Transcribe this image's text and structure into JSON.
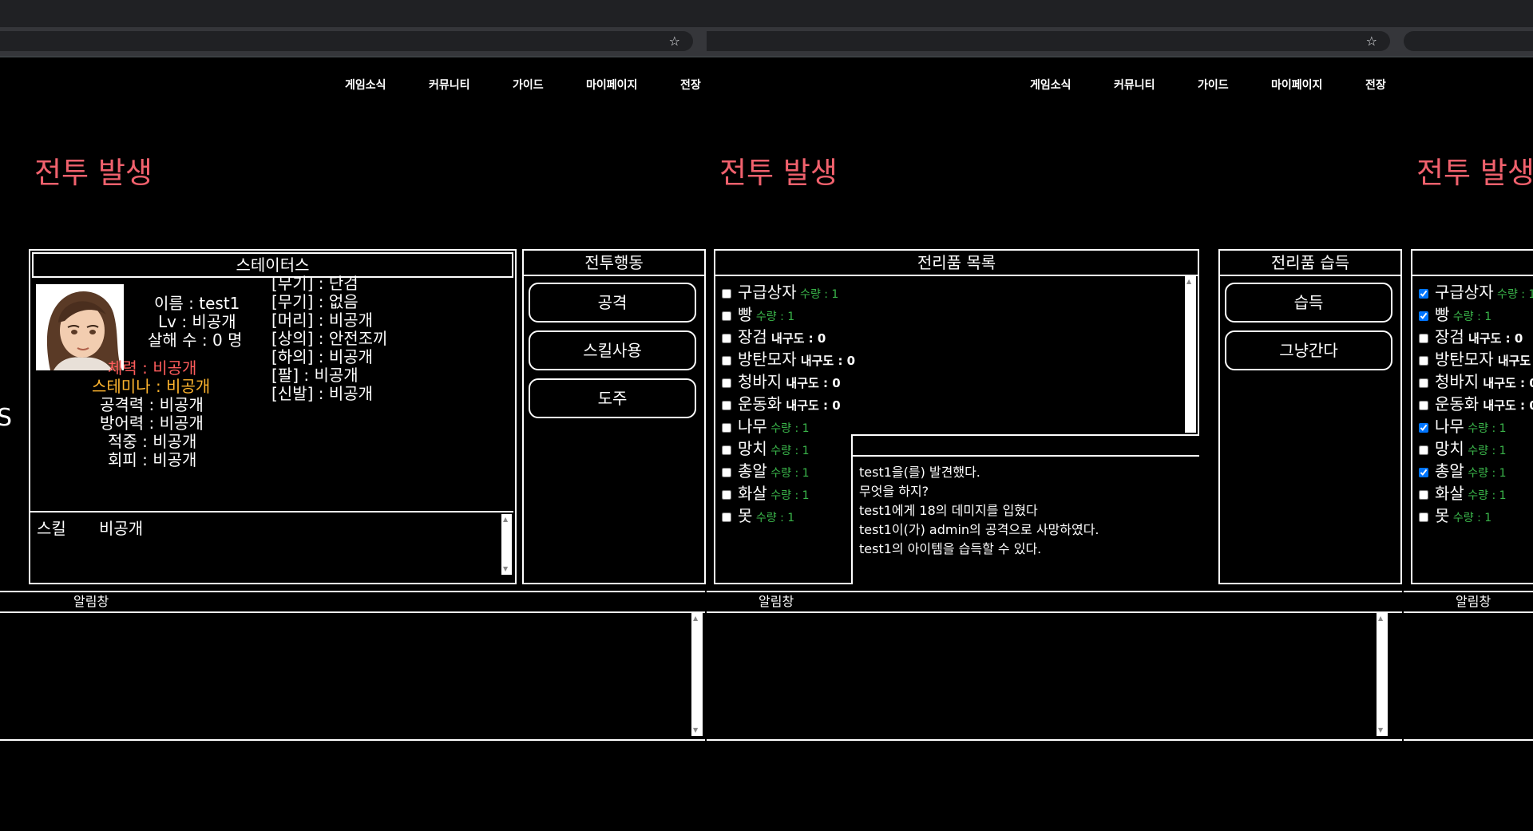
{
  "nav": [
    "게임소식",
    "커뮤니티",
    "가이드",
    "마이페이지",
    "전장"
  ],
  "battle_title": "전투 발생",
  "side_text": "S",
  "status": {
    "header": "스테이터스",
    "name": "이름 : test1",
    "level": "Lv : 비공개",
    "kills": "살해 수 : 0 명",
    "hp": "체력 : 비공개",
    "stamina": "스테미나 : 비공개",
    "attack": "공격력 : 비공개",
    "defense": "방어력 : 비공개",
    "accuracy": "적중 : 비공개",
    "evasion": "회피 : 비공개",
    "equipment": [
      "[무기] : 단검",
      "[무기] : 없음",
      "[머리] : 비공개",
      "[상의] : 안전조끼",
      "[하의] : 비공개",
      "[팔] : 비공개",
      "[신발] : 비공개"
    ],
    "skill_label": "스킬",
    "skill_value": "비공개"
  },
  "actions": {
    "header": "전투행동",
    "buttons": [
      "공격",
      "스킬사용",
      "도주"
    ]
  },
  "notice": {
    "label": "알림창"
  },
  "loot": {
    "header": "전리품 목록",
    "items": [
      {
        "name": "구급상자",
        "stat": "수량 : 1",
        "kind": "qty"
      },
      {
        "name": "빵",
        "stat": "수량 : 1",
        "kind": "qty"
      },
      {
        "name": "장검",
        "stat": "내구도 : 0",
        "kind": "dur"
      },
      {
        "name": "방탄모자",
        "stat": "내구도 : 0",
        "kind": "dur"
      },
      {
        "name": "청바지",
        "stat": "내구도 : 0",
        "kind": "dur"
      },
      {
        "name": "운동화",
        "stat": "내구도 : 0",
        "kind": "dur"
      },
      {
        "name": "나무",
        "stat": "수량 : 1",
        "kind": "qty"
      },
      {
        "name": "망치",
        "stat": "수량 : 1",
        "kind": "qty"
      },
      {
        "name": "총알",
        "stat": "수량 : 1",
        "kind": "qty"
      },
      {
        "name": "화살",
        "stat": "수량 : 1",
        "kind": "qty"
      },
      {
        "name": "못",
        "stat": "수량 : 1",
        "kind": "qty"
      }
    ],
    "checked_third_pane": [
      true,
      true,
      false,
      false,
      false,
      false,
      true,
      false,
      true,
      false,
      false
    ],
    "log": [
      "test1을(를) 발견했다.",
      "무엇을 하지?",
      "test1에게 18의 데미지를 입혔다",
      "test1이(가) admin의 공격으로 사망하였다.",
      "test1의 아이템을 습득할 수 있다."
    ]
  },
  "loot_get": {
    "header": "전리품 습득",
    "buttons": [
      "습득",
      "그냥간다"
    ]
  },
  "colors": {
    "title": "#f0616d",
    "hp": "#ff5c5c",
    "stamina": "#ffb52e",
    "qty": "#3ab54a"
  }
}
